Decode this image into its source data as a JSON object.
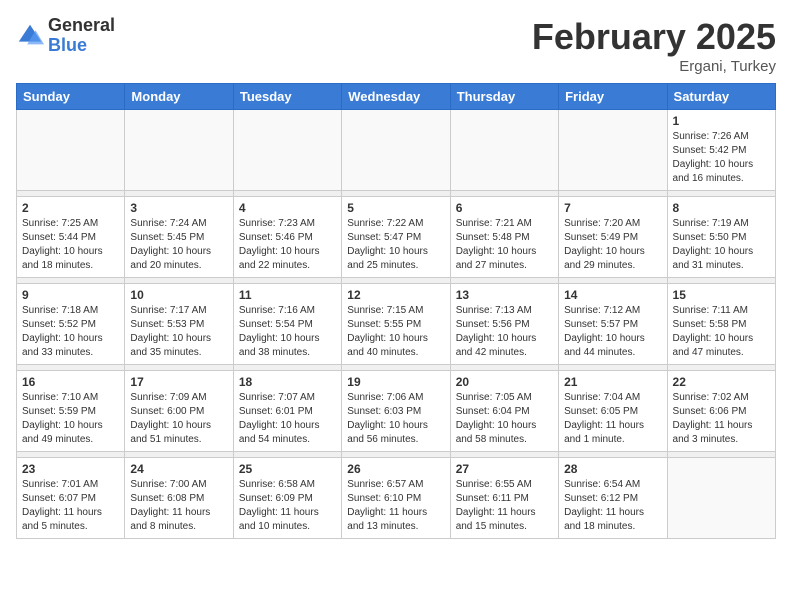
{
  "header": {
    "logo_general": "General",
    "logo_blue": "Blue",
    "month_title": "February 2025",
    "location": "Ergani, Turkey"
  },
  "weekdays": [
    "Sunday",
    "Monday",
    "Tuesday",
    "Wednesday",
    "Thursday",
    "Friday",
    "Saturday"
  ],
  "weeks": [
    [
      {
        "day": "",
        "info": ""
      },
      {
        "day": "",
        "info": ""
      },
      {
        "day": "",
        "info": ""
      },
      {
        "day": "",
        "info": ""
      },
      {
        "day": "",
        "info": ""
      },
      {
        "day": "",
        "info": ""
      },
      {
        "day": "1",
        "info": "Sunrise: 7:26 AM\nSunset: 5:42 PM\nDaylight: 10 hours\nand 16 minutes."
      }
    ],
    [
      {
        "day": "2",
        "info": "Sunrise: 7:25 AM\nSunset: 5:44 PM\nDaylight: 10 hours\nand 18 minutes."
      },
      {
        "day": "3",
        "info": "Sunrise: 7:24 AM\nSunset: 5:45 PM\nDaylight: 10 hours\nand 20 minutes."
      },
      {
        "day": "4",
        "info": "Sunrise: 7:23 AM\nSunset: 5:46 PM\nDaylight: 10 hours\nand 22 minutes."
      },
      {
        "day": "5",
        "info": "Sunrise: 7:22 AM\nSunset: 5:47 PM\nDaylight: 10 hours\nand 25 minutes."
      },
      {
        "day": "6",
        "info": "Sunrise: 7:21 AM\nSunset: 5:48 PM\nDaylight: 10 hours\nand 27 minutes."
      },
      {
        "day": "7",
        "info": "Sunrise: 7:20 AM\nSunset: 5:49 PM\nDaylight: 10 hours\nand 29 minutes."
      },
      {
        "day": "8",
        "info": "Sunrise: 7:19 AM\nSunset: 5:50 PM\nDaylight: 10 hours\nand 31 minutes."
      }
    ],
    [
      {
        "day": "9",
        "info": "Sunrise: 7:18 AM\nSunset: 5:52 PM\nDaylight: 10 hours\nand 33 minutes."
      },
      {
        "day": "10",
        "info": "Sunrise: 7:17 AM\nSunset: 5:53 PM\nDaylight: 10 hours\nand 35 minutes."
      },
      {
        "day": "11",
        "info": "Sunrise: 7:16 AM\nSunset: 5:54 PM\nDaylight: 10 hours\nand 38 minutes."
      },
      {
        "day": "12",
        "info": "Sunrise: 7:15 AM\nSunset: 5:55 PM\nDaylight: 10 hours\nand 40 minutes."
      },
      {
        "day": "13",
        "info": "Sunrise: 7:13 AM\nSunset: 5:56 PM\nDaylight: 10 hours\nand 42 minutes."
      },
      {
        "day": "14",
        "info": "Sunrise: 7:12 AM\nSunset: 5:57 PM\nDaylight: 10 hours\nand 44 minutes."
      },
      {
        "day": "15",
        "info": "Sunrise: 7:11 AM\nSunset: 5:58 PM\nDaylight: 10 hours\nand 47 minutes."
      }
    ],
    [
      {
        "day": "16",
        "info": "Sunrise: 7:10 AM\nSunset: 5:59 PM\nDaylight: 10 hours\nand 49 minutes."
      },
      {
        "day": "17",
        "info": "Sunrise: 7:09 AM\nSunset: 6:00 PM\nDaylight: 10 hours\nand 51 minutes."
      },
      {
        "day": "18",
        "info": "Sunrise: 7:07 AM\nSunset: 6:01 PM\nDaylight: 10 hours\nand 54 minutes."
      },
      {
        "day": "19",
        "info": "Sunrise: 7:06 AM\nSunset: 6:03 PM\nDaylight: 10 hours\nand 56 minutes."
      },
      {
        "day": "20",
        "info": "Sunrise: 7:05 AM\nSunset: 6:04 PM\nDaylight: 10 hours\nand 58 minutes."
      },
      {
        "day": "21",
        "info": "Sunrise: 7:04 AM\nSunset: 6:05 PM\nDaylight: 11 hours\nand 1 minute."
      },
      {
        "day": "22",
        "info": "Sunrise: 7:02 AM\nSunset: 6:06 PM\nDaylight: 11 hours\nand 3 minutes."
      }
    ],
    [
      {
        "day": "23",
        "info": "Sunrise: 7:01 AM\nSunset: 6:07 PM\nDaylight: 11 hours\nand 5 minutes."
      },
      {
        "day": "24",
        "info": "Sunrise: 7:00 AM\nSunset: 6:08 PM\nDaylight: 11 hours\nand 8 minutes."
      },
      {
        "day": "25",
        "info": "Sunrise: 6:58 AM\nSunset: 6:09 PM\nDaylight: 11 hours\nand 10 minutes."
      },
      {
        "day": "26",
        "info": "Sunrise: 6:57 AM\nSunset: 6:10 PM\nDaylight: 11 hours\nand 13 minutes."
      },
      {
        "day": "27",
        "info": "Sunrise: 6:55 AM\nSunset: 6:11 PM\nDaylight: 11 hours\nand 15 minutes."
      },
      {
        "day": "28",
        "info": "Sunrise: 6:54 AM\nSunset: 6:12 PM\nDaylight: 11 hours\nand 18 minutes."
      },
      {
        "day": "",
        "info": ""
      }
    ]
  ]
}
